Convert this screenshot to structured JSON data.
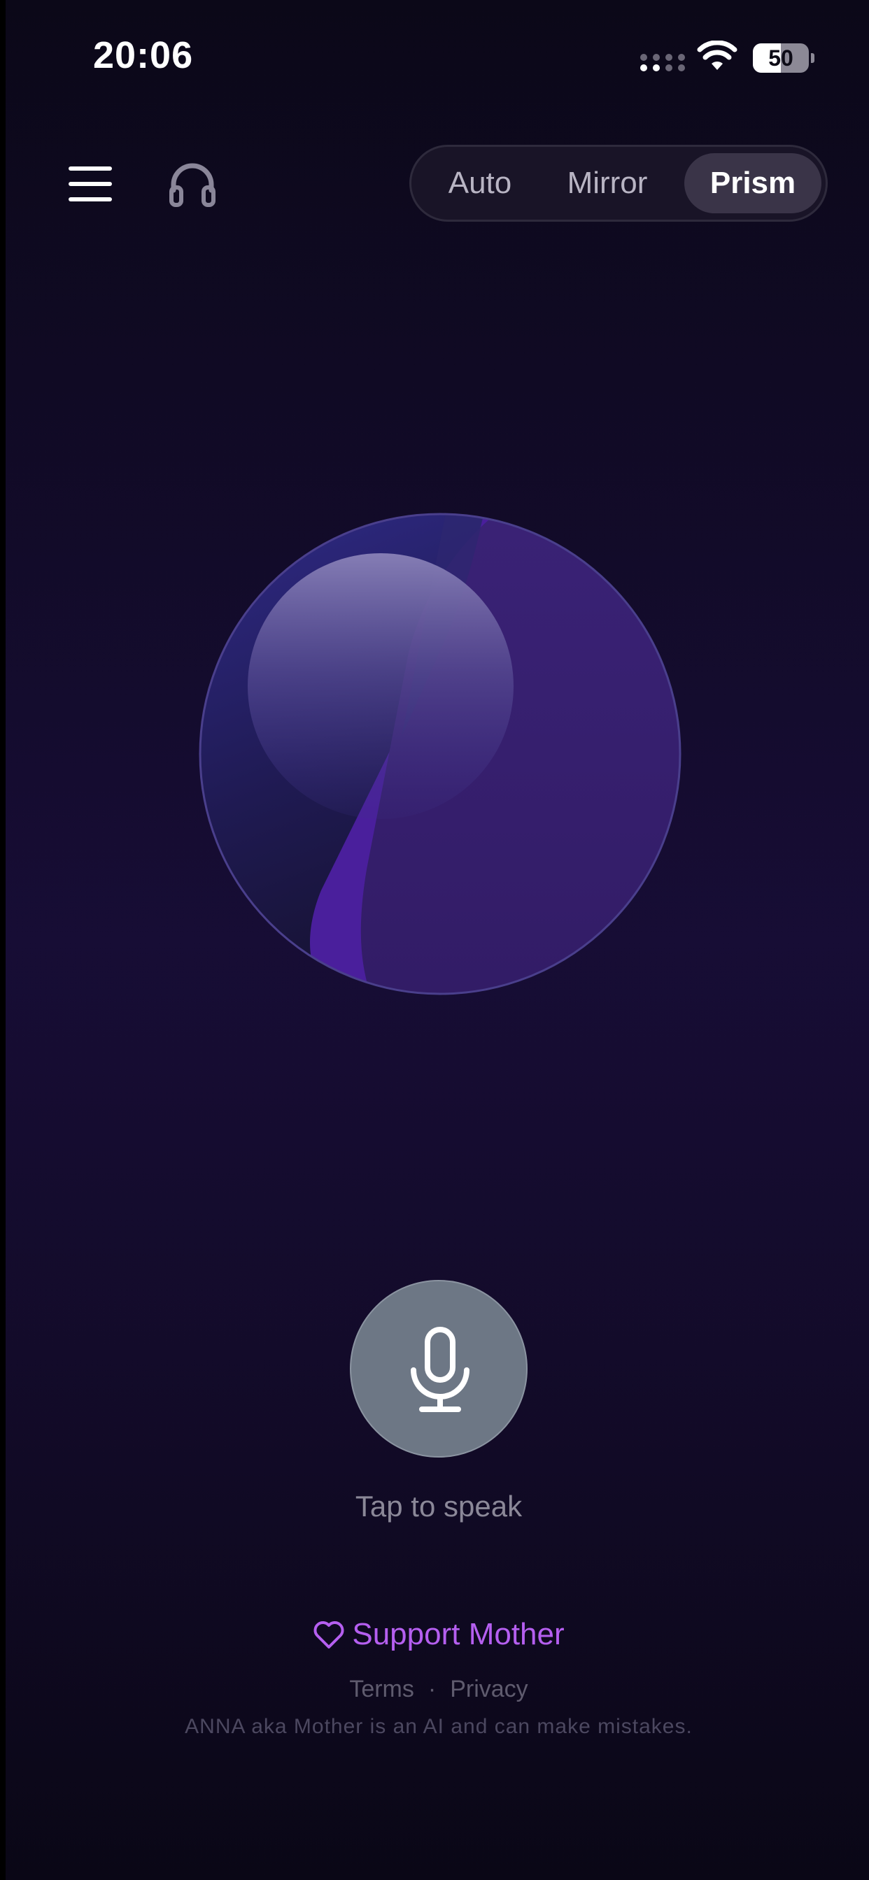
{
  "status_bar": {
    "time": "20:06",
    "battery_percent": "50"
  },
  "toolbar": {
    "menu_icon": "hamburger-menu-icon",
    "headphones_icon": "headphones-icon",
    "modes": [
      {
        "label": "Auto",
        "selected": false
      },
      {
        "label": "Mirror",
        "selected": false
      },
      {
        "label": "Prism",
        "selected": true
      }
    ]
  },
  "orb": {
    "colors": {
      "base": "#342068",
      "highlight": "#8a82b8",
      "accent": "#4f22a6"
    }
  },
  "voice": {
    "mic_icon": "microphone-icon",
    "hint": "Tap to speak",
    "button_color": "#6d7785"
  },
  "footer": {
    "support_icon": "heart-icon",
    "support_label": "Support Mother",
    "support_color": "#b55ff0",
    "terms_label": "Terms",
    "separator": "·",
    "privacy_label": "Privacy",
    "disclaimer": "ANNA aka Mother is an AI and can make mistakes."
  }
}
